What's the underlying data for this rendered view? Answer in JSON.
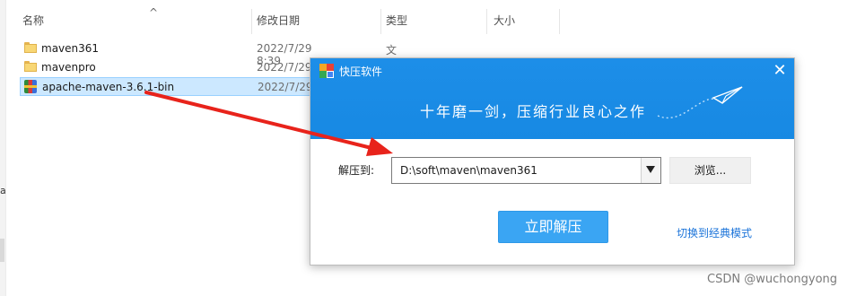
{
  "explorer": {
    "columns": [
      "名称",
      "修改日期",
      "类型",
      "大小"
    ],
    "sort_indicator": "^",
    "rows": [
      {
        "name": "maven361",
        "date": "2022/7/29 8:39",
        "type": "文件夹",
        "icon": "folder-icon"
      },
      {
        "name": "mavenpro",
        "date": "2022/7/29",
        "type": "",
        "icon": "folder-icon"
      },
      {
        "name": "apache-maven-3.6.1-bin",
        "date": "2022/7/29",
        "type": "",
        "icon": "archive-icon"
      }
    ],
    "left_edge_letter": "a"
  },
  "dialog": {
    "title": "快压软件",
    "close_glyph": "✕",
    "slogan": "十年磨一剑，压缩行业良心之作",
    "extract_label": "解压到:",
    "path_value": "D:\\soft\\maven\\maven361",
    "browse_label": "浏览...",
    "extract_now_label": "立即解压",
    "switch_mode_label": "切换到经典模式",
    "header_color": "#1789e3",
    "button_color": "#3aa5f3"
  },
  "annotation": {
    "arrow_color": "#e8231b"
  },
  "watermark": "CSDN @wuchongyong"
}
